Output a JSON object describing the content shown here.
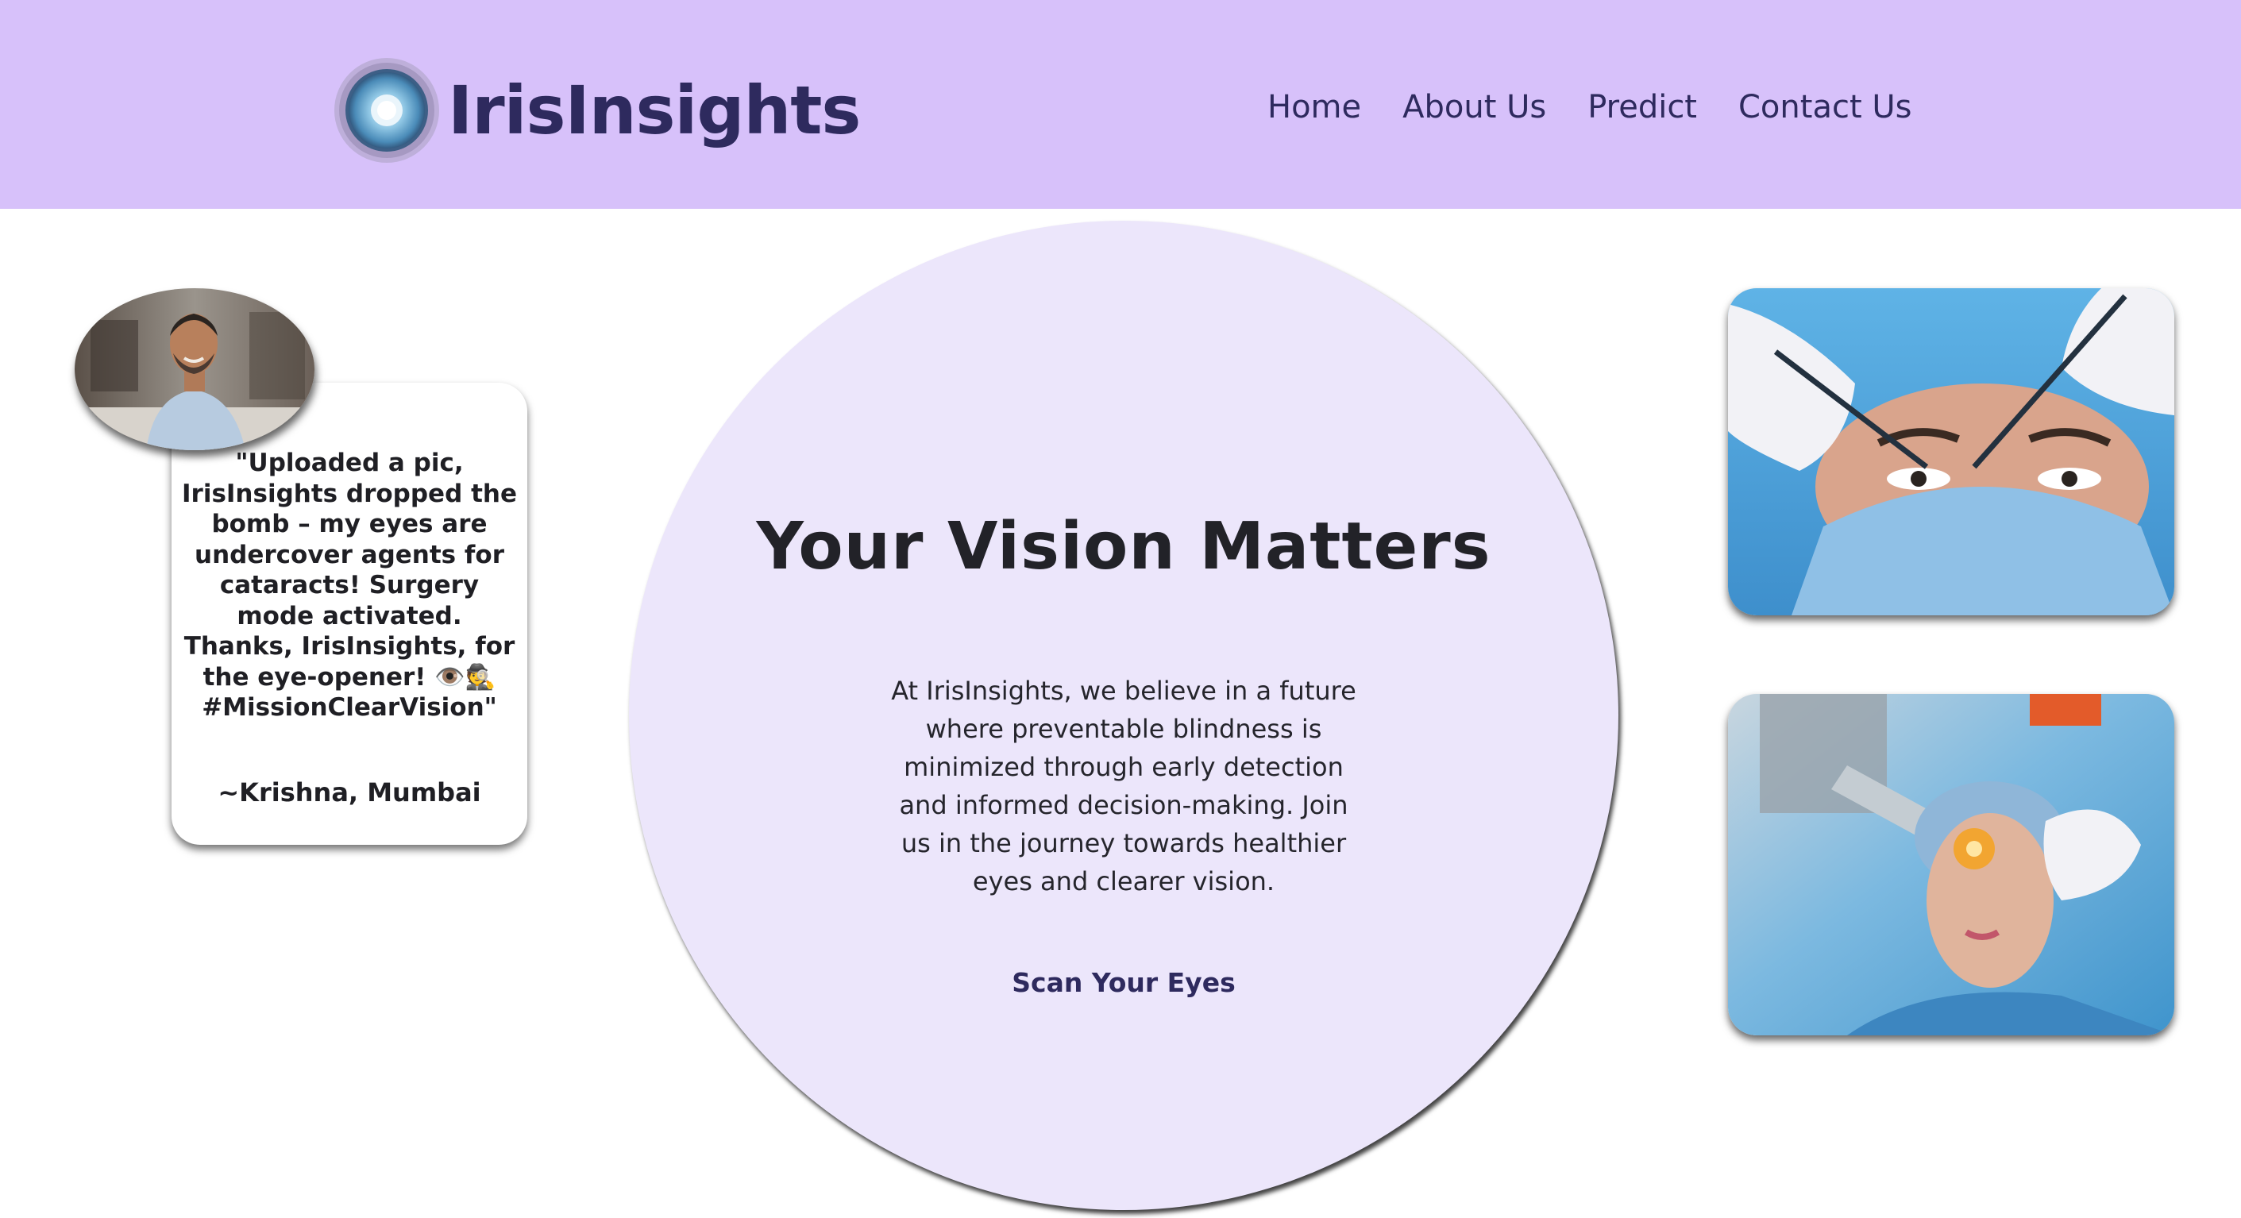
{
  "brand": {
    "name": "IrisInsights",
    "logo_icon": "iris-eye-icon",
    "accent_color": "#d7c1fa",
    "text_color": "#2e2a5e"
  },
  "nav": {
    "items": [
      {
        "label": "Home"
      },
      {
        "label": "About Us"
      },
      {
        "label": "Predict"
      },
      {
        "label": "Contact Us"
      }
    ]
  },
  "testimonial": {
    "quote": "\"Uploaded a pic, IrisInsights dropped the bomb – my eyes are undercover agents for cataracts! Surgery mode activated. Thanks, IrisInsights, for the eye-opener! 👁️🕵️ #MissionClearVision\"",
    "author": "~Krishna, Mumbai"
  },
  "hero": {
    "title": "Your Vision Matters",
    "text": "At IrisInsights, we believe in a future where preventable blindness is minimized through early detection and informed decision-making. Join us in the journey towards healthier eyes and clearer vision.",
    "cta_label": "Scan Your Eyes",
    "background": "#ece6fb"
  },
  "images": [
    {
      "name": "eye-surgery-photo"
    },
    {
      "name": "laser-eye-exam-photo"
    }
  ]
}
